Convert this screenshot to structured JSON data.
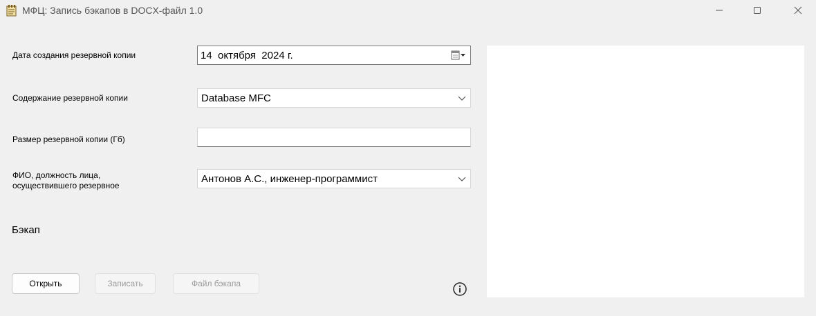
{
  "window": {
    "title": "МФЦ: Запись бэкапов в DOCX-файл 1.0",
    "app_icon": "notepad-icon",
    "controls": [
      "minimize-icon",
      "maximize-icon",
      "close-icon"
    ]
  },
  "form": {
    "backup_date": {
      "label": "Дата создания резервной копии",
      "value": "14  октября  2024 г."
    },
    "backup_content": {
      "label": "Содержание резервной копии",
      "value": "Database MFC"
    },
    "backup_size": {
      "label": "Размер резервной копии (Гб)",
      "value": ""
    },
    "responsible_person": {
      "label_line1": "ФИО, должность лица,",
      "label_line2": "осуществившего резервное",
      "value": "Антонов А.С., инженер-программист"
    }
  },
  "backup_section": {
    "label": "Бэкап"
  },
  "buttons": {
    "open": "Открыть",
    "write": "Записать",
    "backup_file": "Файл бэкапа"
  },
  "colors": {
    "window_bg": "#f0f0f0",
    "field_bg": "#ffffff",
    "disabled_text": "#9a9a9a"
  }
}
